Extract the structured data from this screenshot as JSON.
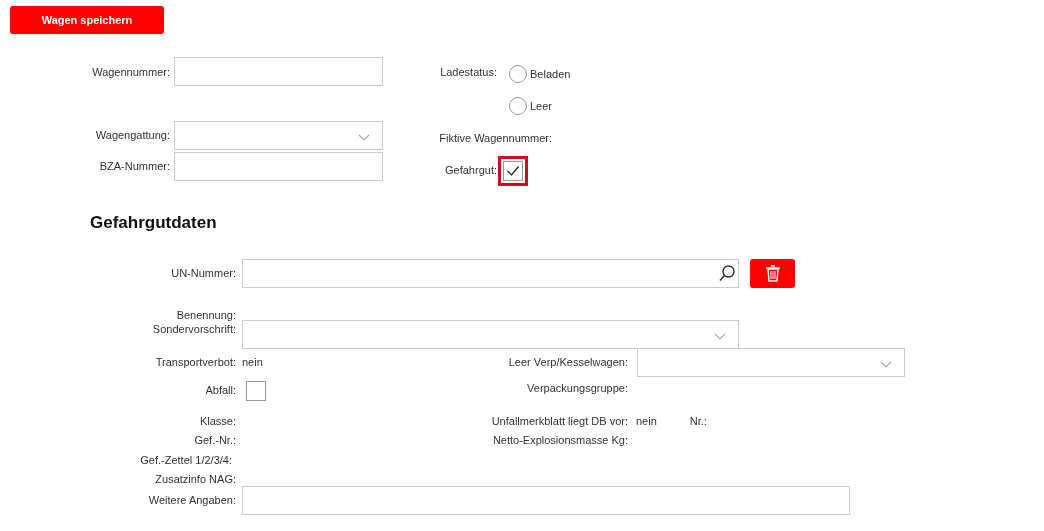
{
  "save_button": "Wagen speichern",
  "wagon": {
    "wagennummer": {
      "label": "Wagennummer:"
    },
    "wagengattung": {
      "label": "Wagengattung:"
    },
    "bza": {
      "label": "BZA-Nummer:"
    },
    "ladestatus": {
      "label": "Ladestatus:",
      "options": [
        {
          "label": "Beladen",
          "selected": false
        },
        {
          "label": "Leer",
          "selected": false
        }
      ]
    },
    "fiktive": {
      "label": "Fiktive Wagennummer:"
    },
    "gefahrgut": {
      "label": "Gefahrgut:",
      "checked": true
    }
  },
  "section_title": "Gefahrgutdaten",
  "dg": {
    "un": {
      "label": "UN-Nummer:"
    },
    "benennung": {
      "label": "Benennung:"
    },
    "sondervorschrift": {
      "label": "Sondervorschrift:"
    },
    "transportverbot": {
      "label": "Transportverbot:",
      "value": "nein"
    },
    "leer_verp": {
      "label": "Leer Verp/Kesselwagen:"
    },
    "abfall": {
      "label": "Abfall:",
      "checked": false
    },
    "verpackungsgruppe": {
      "label": "Verpackungsgruppe:"
    },
    "klasse": {
      "label": "Klasse:"
    },
    "unfallmerkblatt": {
      "label": "Unfallmerkblatt liegt DB vor:",
      "value": "nein"
    },
    "nr": {
      "label": "Nr.:"
    },
    "gefnr": {
      "label": "Gef.-Nr.:"
    },
    "netto": {
      "label": "Netto-Explosionsmasse Kg:"
    },
    "gefzettel": {
      "label": "Gef.-Zettel 1/2/3/4:"
    },
    "zusatzinfo": {
      "label": "Zusatzinfo NAG:"
    },
    "weitere": {
      "label": "Weitere Angaben:"
    }
  }
}
